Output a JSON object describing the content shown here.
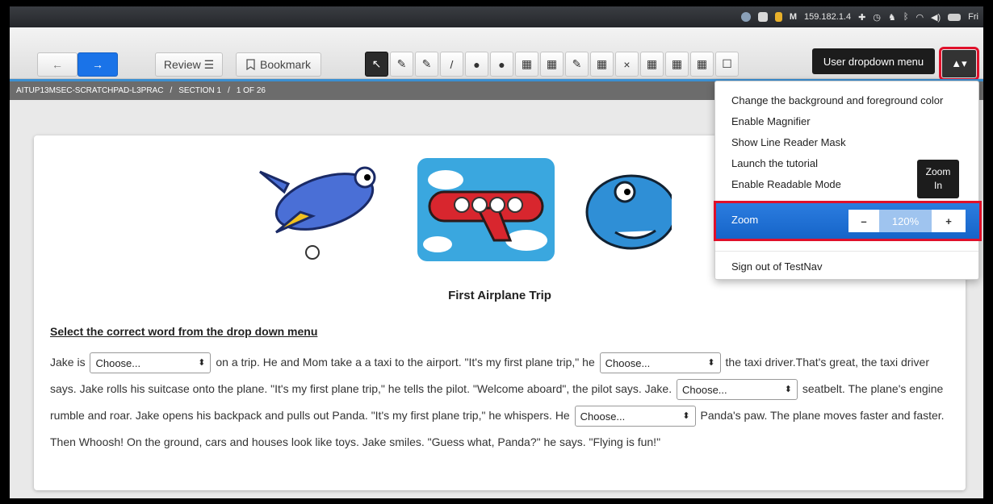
{
  "menubar": {
    "ip": "159.182.1.4",
    "day": "Fri"
  },
  "toolbar": {
    "back_icon": "←",
    "next_icon": "→",
    "review_label": "Review ☰",
    "bookmark_label": "Bookmark",
    "user_tooltip": "User dropdown menu",
    "user_button": "▲▾"
  },
  "tools": [
    "↖",
    "✎",
    "✎",
    "/",
    "●",
    "●",
    "▦",
    "▦",
    "✎",
    "▦",
    "×",
    "▦",
    "▦",
    "▦",
    "☐"
  ],
  "breadcrumb": {
    "test": "AITUP13MSEC-SCRATCHPAD-L3PRAC",
    "sep1": "/",
    "section": "SECTION 1",
    "sep2": "/",
    "page": "1 OF 26"
  },
  "user_menu": {
    "items": [
      "Change the background and foreground color",
      "Enable Magnifier",
      "Show Line Reader Mask",
      "Launch the tutorial",
      "Enable Readable Mode"
    ],
    "zoom_label": "Zoom",
    "zoom_minus": "–",
    "zoom_value": "120%",
    "zoom_plus": "+",
    "zoom_tooltip_line1": "Zoom",
    "zoom_tooltip_line2": "In",
    "signout": "Sign out of TestNav"
  },
  "content": {
    "title": "First Airplane Trip",
    "instruction": "Select the correct word from the drop down menu",
    "select_placeholder": "Choose...",
    "t1": "Jake is",
    "t2": "on a trip. He and Mom take a a taxi to the airport. \"It's my first plane trip,\" he",
    "t3": "the taxi driver.That's great, the taxi driver says. Jake rolls his suitcase onto the plane. \"It's my first plane trip,\" he tells the pilot. \"Welcome aboard\", the pilot says. Jake.",
    "t4": "seatbelt. The plane's engine rumble and roar. Jake opens his backpack and pulls out Panda. \"It's my first plane trip,\" he whispers. He",
    "t5": "Panda's paw. The plane moves faster and faster. Then Whoosh! On the ground, cars and houses look like toys. Jake smiles. \"Guess what, Panda?\" he says. \"Flying is fun!\""
  },
  "colors": {
    "accent": "#1a73e8",
    "highlight": "#e0102a"
  }
}
